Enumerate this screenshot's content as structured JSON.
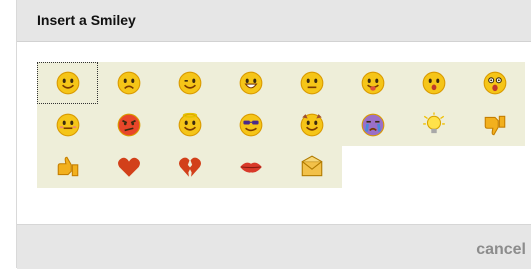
{
  "dialog": {
    "title": "Insert a Smiley",
    "cancel_label": "cancel"
  },
  "smileys": [
    {
      "name": "smile-icon"
    },
    {
      "name": "sad-icon"
    },
    {
      "name": "wink-icon"
    },
    {
      "name": "grin-icon"
    },
    {
      "name": "frown-icon"
    },
    {
      "name": "tongue-out-icon"
    },
    {
      "name": "surprised-icon"
    },
    {
      "name": "shocked-icon"
    },
    {
      "name": "embarrassed-icon"
    },
    {
      "name": "angry-icon"
    },
    {
      "name": "angel-icon"
    },
    {
      "name": "cool-sunglasses-icon"
    },
    {
      "name": "devil-icon"
    },
    {
      "name": "crying-icon"
    },
    {
      "name": "lightbulb-icon"
    },
    {
      "name": "thumbs-down-icon"
    },
    {
      "name": "thumbs-up-icon"
    },
    {
      "name": "heart-icon"
    },
    {
      "name": "broken-heart-icon"
    },
    {
      "name": "kiss-lips-icon"
    },
    {
      "name": "envelope-icon"
    }
  ],
  "colors": {
    "grid_bg": "#eeeed9",
    "face": "#f5c518",
    "face_edge": "#d99a00",
    "heart": "#d2401a",
    "footer_bg": "#e6e6e6",
    "cancel_text": "#8c8c8c"
  }
}
